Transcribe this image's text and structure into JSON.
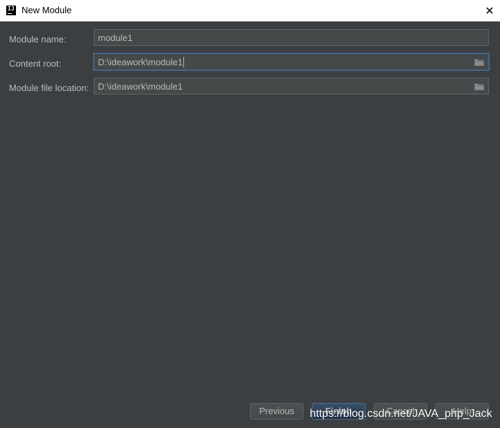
{
  "window": {
    "title": "New Module",
    "app_icon_text": "IJ",
    "close_glyph": "✕"
  },
  "form": {
    "module_name": {
      "label": "Module name:",
      "value": "module1"
    },
    "content_root": {
      "label": "Content root:",
      "value": "D:\\ideawork\\module1",
      "focused": true
    },
    "module_file_location": {
      "label": "Module file location:",
      "value": "D:\\ideawork\\module1"
    }
  },
  "buttons": {
    "previous": "Previous",
    "finish": "Finish",
    "cancel": "Cancel",
    "help": "Help"
  },
  "watermark": "https://blog.csdn.net/JAVA_php_Jack",
  "icons": {
    "app": "intellij-icon",
    "close": "close-icon",
    "browse": "folder-icon"
  },
  "colors": {
    "background": "#3c3f41",
    "field_background": "#45494a",
    "text": "#bbbbbb",
    "focus_border": "#466d94",
    "default_button": "#365880"
  }
}
